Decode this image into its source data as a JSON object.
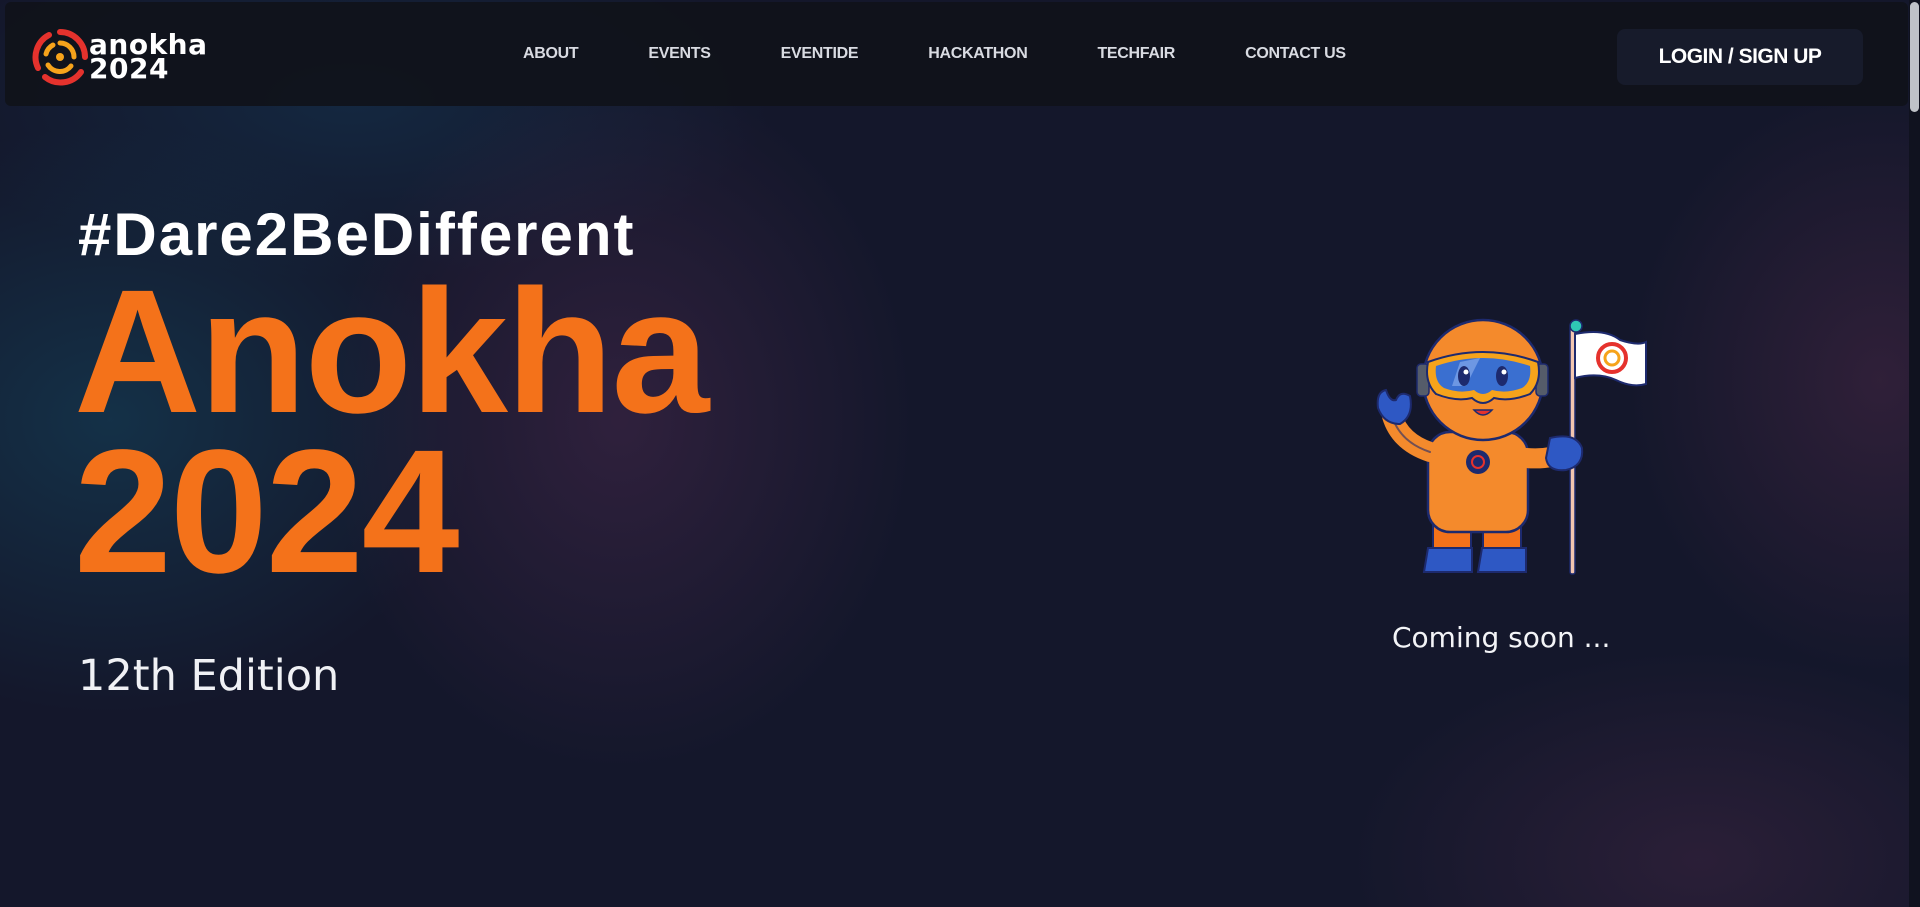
{
  "brand": {
    "line1": "anokha",
    "line2": "2024",
    "colors": {
      "accent": "#f4721a",
      "logo_red": "#e5322d",
      "logo_orange": "#f6a31b"
    }
  },
  "nav": {
    "items": [
      {
        "label": "ABOUT"
      },
      {
        "label": "EVENTS"
      },
      {
        "label": "EVENTIDE"
      },
      {
        "label": "HACKATHON"
      },
      {
        "label": "TECHFAIR"
      },
      {
        "label": "CONTACT US"
      }
    ],
    "login_label": "LOGIN / SIGN UP"
  },
  "hero": {
    "hashtag": "#Dare2BeDifferent",
    "title_line1": "Anokha",
    "title_line2": "2024",
    "edition": "12th Edition"
  },
  "mascot": {
    "icon": "astronaut-with-flag-icon",
    "caption": "Coming soon ..."
  }
}
